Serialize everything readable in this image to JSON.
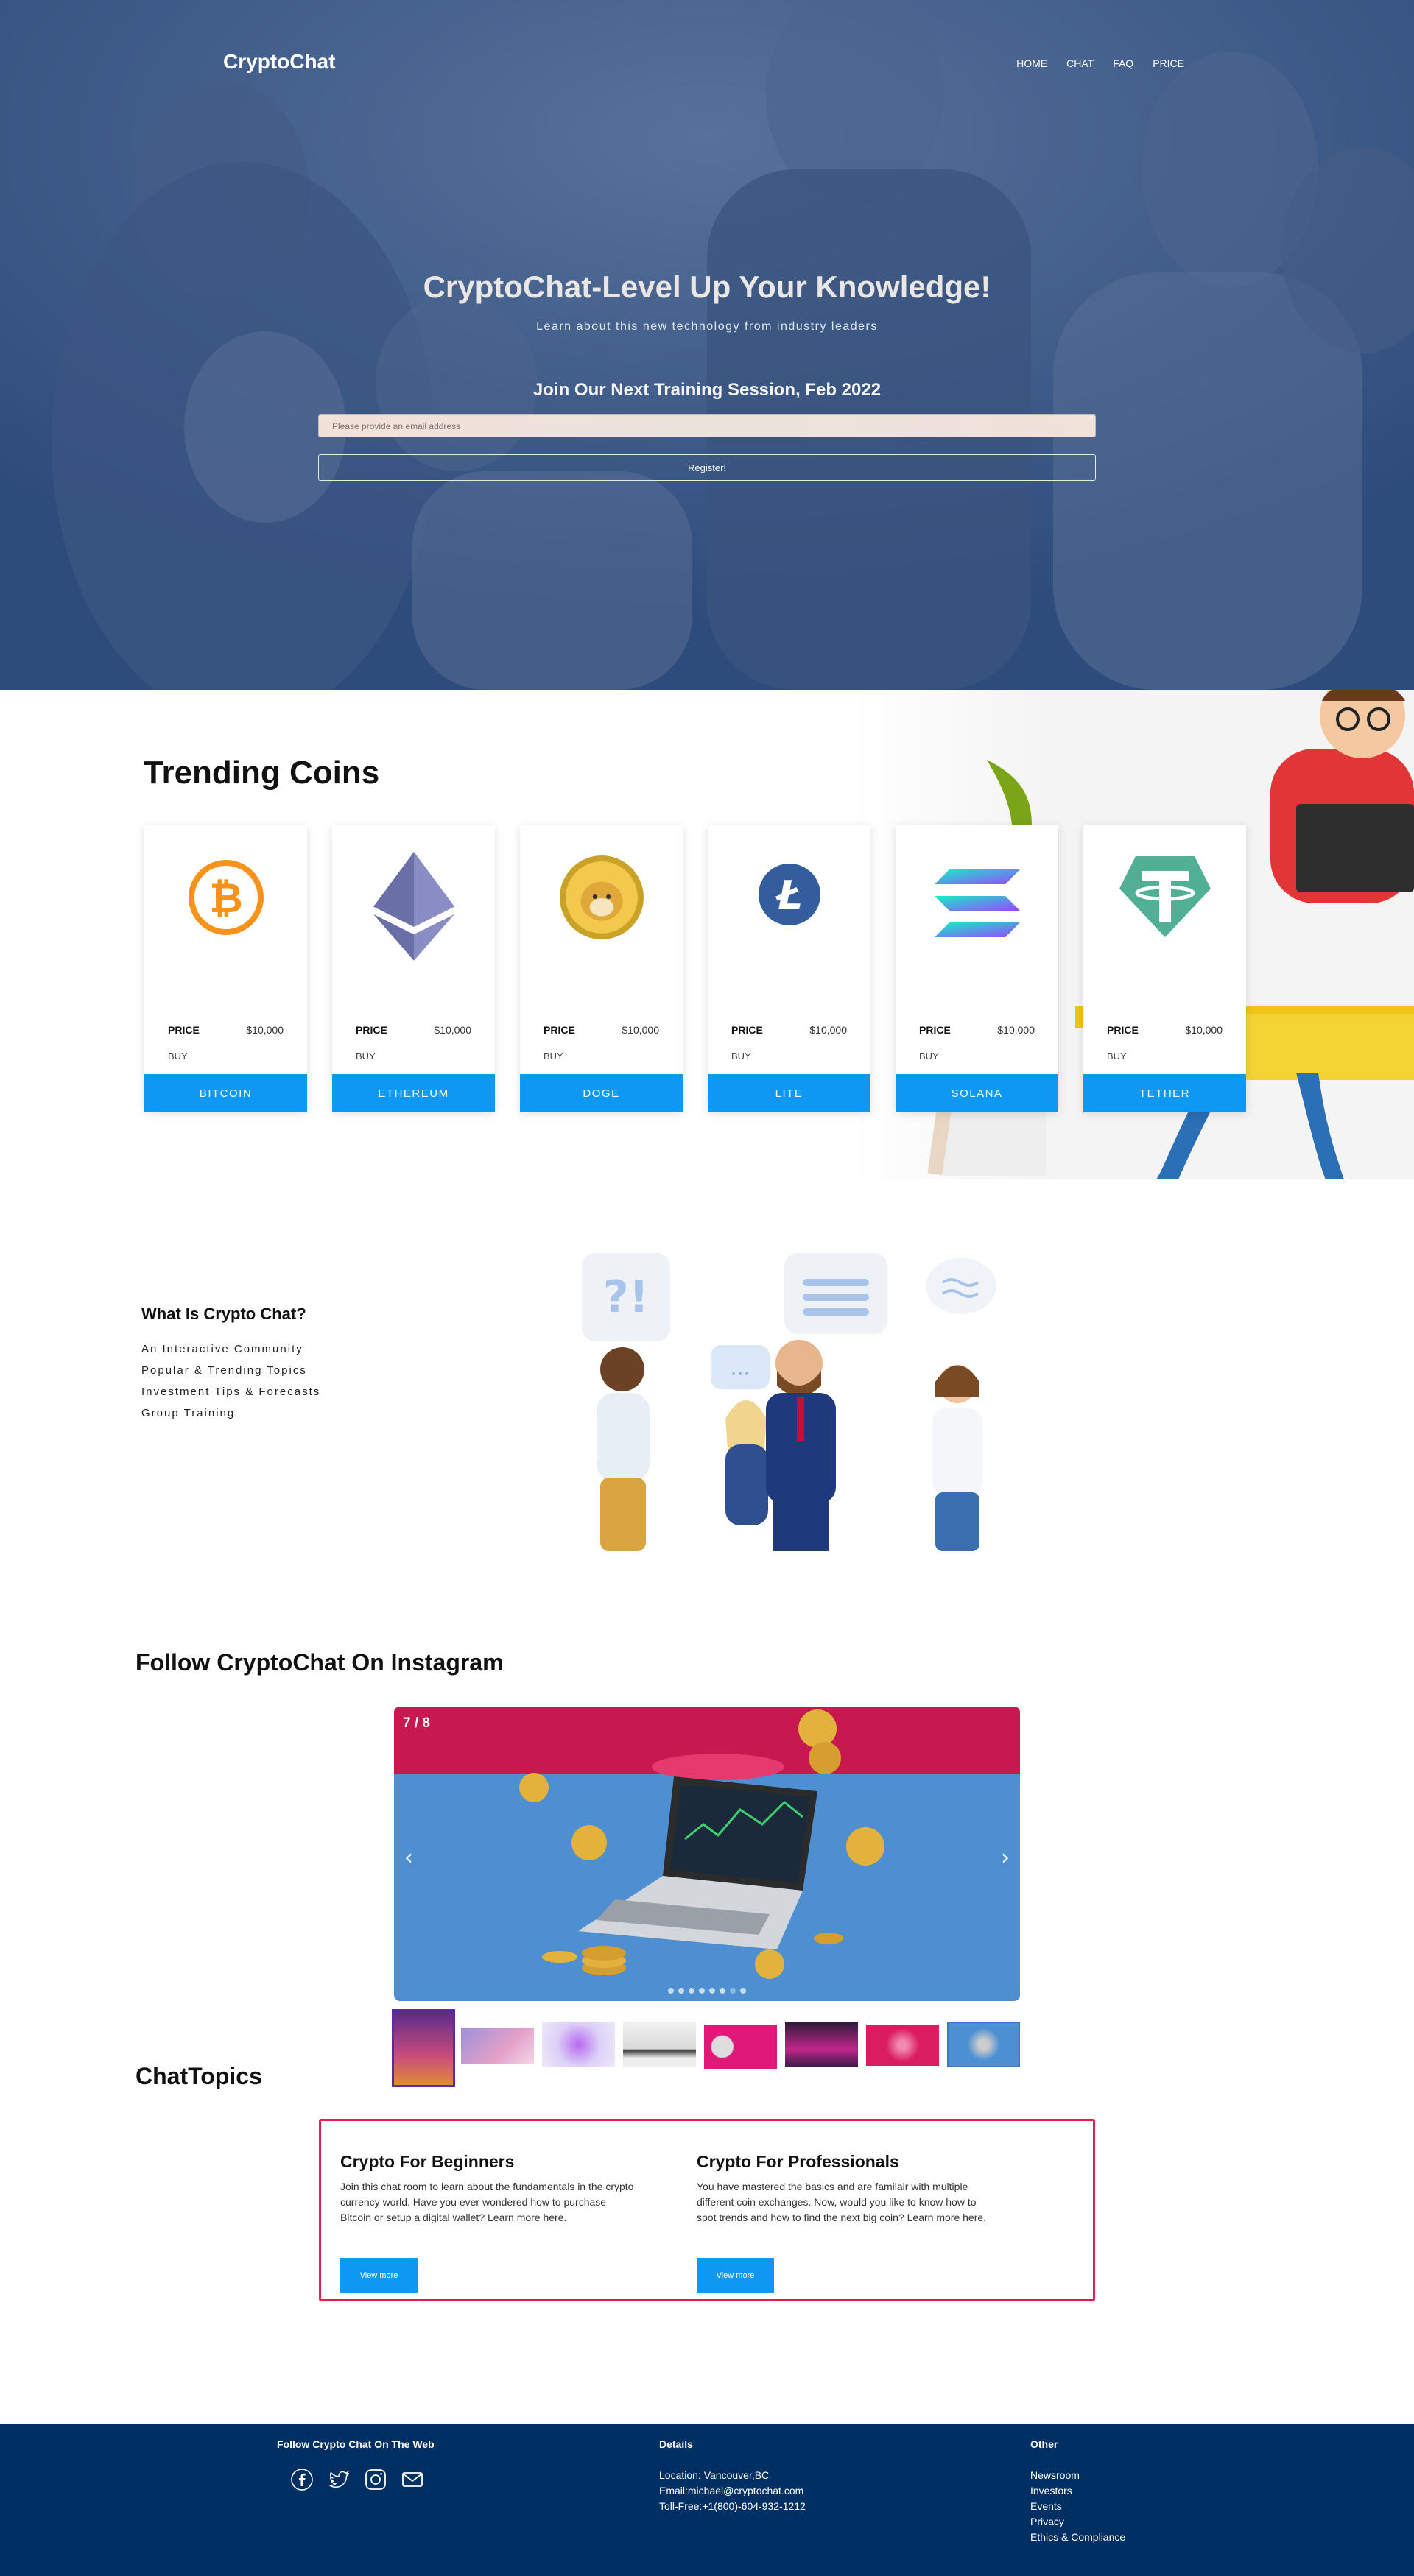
{
  "header": {
    "brand": "CryptoChat",
    "nav": [
      "HOME",
      "CHAT",
      "FAQ",
      "PRICE"
    ]
  },
  "hero": {
    "title": "CryptoChat-Level Up Your Knowledge!",
    "subtitle": "Learn about this new technology from industry leaders",
    "session_heading": "Join Our Next Training Session, Feb 2022",
    "email_placeholder": "Please provide an email address",
    "register_label": "Register!"
  },
  "trending": {
    "title": "Trending Coins",
    "price_label": "PRICE",
    "buy_label": "BUY",
    "coins": [
      {
        "name": "BITCOIN",
        "price": "$10,000",
        "icon": "bitcoin-icon",
        "color": "#f7931a"
      },
      {
        "name": "ETHEREUM",
        "price": "$10,000",
        "icon": "ethereum-icon",
        "color": "#6b6fa8"
      },
      {
        "name": "DOGE",
        "price": "$10,000",
        "icon": "doge-icon",
        "color": "#e6b82a"
      },
      {
        "name": "LITE",
        "price": "$10,000",
        "icon": "litecoin-icon",
        "color": "#345d9d"
      },
      {
        "name": "SOLANA",
        "price": "$10,000",
        "icon": "solana-icon",
        "color": "#9945ff"
      },
      {
        "name": "TETHER",
        "price": "$10,000",
        "icon": "tether-icon",
        "color": "#50af95"
      }
    ]
  },
  "what": {
    "title": "What Is Crypto Chat?",
    "items": [
      "An Interactive Community",
      "Popular & Trending Topics",
      "Investment Tips & Forecasts",
      "Group Training"
    ]
  },
  "instagram": {
    "title": "Follow CryptoChat On Instagram",
    "counter": "7 / 8",
    "prev": "‹",
    "next": "›",
    "thumb_count": 8,
    "active_dot": 6
  },
  "topics": {
    "title": "ChatTopics",
    "items": [
      {
        "heading": "Crypto For Beginners",
        "text": "Join this chat room to learn about the fundamentals in the crypto currency world. Have you ever wondered how to purchase Bitcoin or setup a digital wallet? Learn more here.",
        "button": "View more"
      },
      {
        "heading": "Crypto For Professionals",
        "text": "You have mastered the basics and are familair with multiple different coin exchanges. Now, would you like to know how to spot trends and how to find the next big coin? Learn more here.",
        "button": "View more"
      }
    ]
  },
  "footer": {
    "follow_title": "Follow Crypto Chat On The Web",
    "social_icons": [
      "facebook-icon",
      "twitter-icon",
      "instagram-icon",
      "mail-icon"
    ],
    "details_title": "Details",
    "details": [
      "Location: Vancouver,BC",
      "Email:michael@cryptochat.com",
      "Toll-Free:+1(800)-604-932-1212"
    ],
    "other_title": "Other",
    "other_links": [
      "Newsroom",
      "Investors",
      "Events",
      "Privacy",
      "Ethics & Compliance"
    ]
  },
  "colors": {
    "accent": "#0d99f3",
    "footer": "#002f63",
    "topics_border": "#e51d48",
    "hero": "#3a5a8c"
  }
}
